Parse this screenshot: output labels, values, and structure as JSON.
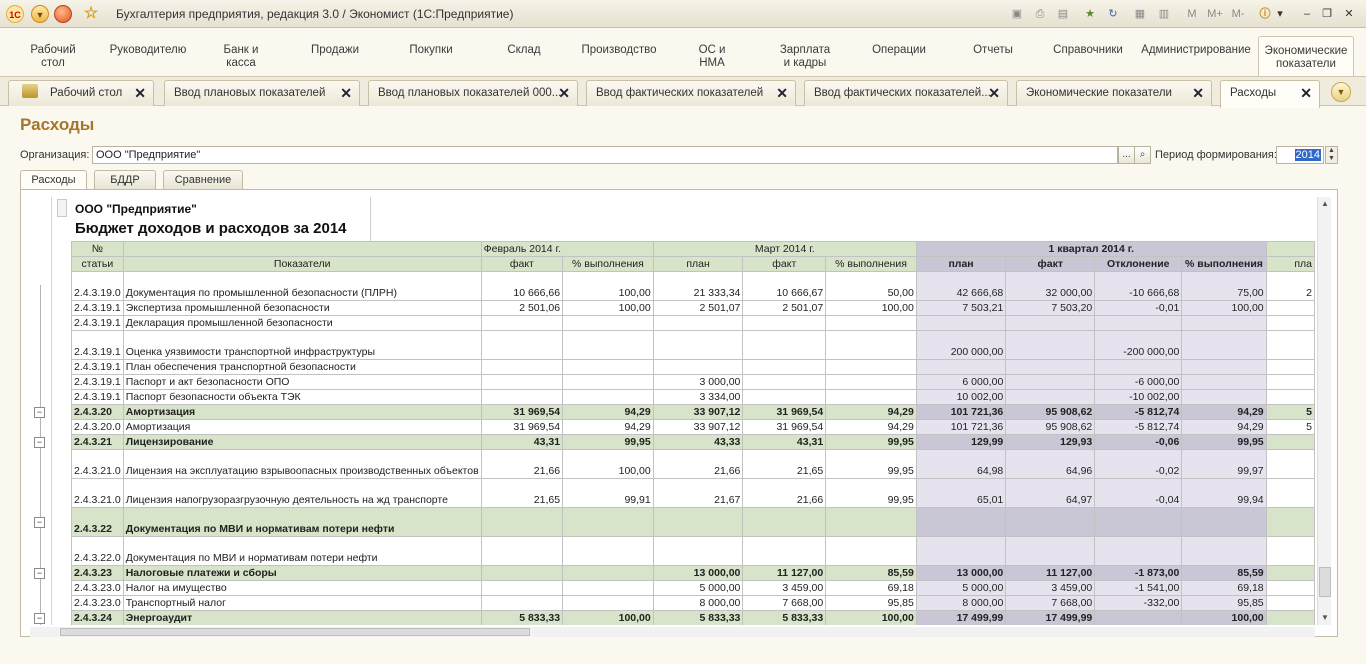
{
  "app": {
    "title": "Бухгалтерия предприятия, редакция 3.0 / Экономист  (1С:Предприятие)"
  },
  "titlebar_right": [
    "M",
    "M+",
    "M-"
  ],
  "sections": [
    {
      "label": "Рабочий\nстол"
    },
    {
      "label": "Руководителю"
    },
    {
      "label": "Банк и\nкасса"
    },
    {
      "label": "Продажи"
    },
    {
      "label": "Покупки"
    },
    {
      "label": "Склад"
    },
    {
      "label": "Производство"
    },
    {
      "label": "ОС и\nНМА"
    },
    {
      "label": "Зарплата\nи кадры"
    },
    {
      "label": "Операции"
    },
    {
      "label": "Отчеты"
    },
    {
      "label": "Справочники"
    },
    {
      "label": "Администрирование"
    },
    {
      "label": "Экономические\nпоказатели",
      "active": true
    }
  ],
  "tabs": [
    {
      "label": "Рабочий стол"
    },
    {
      "label": "Ввод плановых показателей"
    },
    {
      "label": "Ввод плановых показателей 000..."
    },
    {
      "label": "Ввод фактических показателей"
    },
    {
      "label": "Ввод фактических показателей..."
    },
    {
      "label": "Экономические показатели"
    },
    {
      "label": "Расходы",
      "active": true
    }
  ],
  "page": {
    "title": "Расходы",
    "org_label": "Организация:",
    "org_value": "ООО \"Предприятие\"",
    "period_label": "Период формирования:",
    "period_value": "2014",
    "subtabs": [
      "Расходы",
      "БДДР",
      "Сравнение"
    ]
  },
  "report": {
    "org": "ООО \"Предприятие\"",
    "title": "Бюджет доходов и расходов за 2014",
    "headers": {
      "no": "№",
      "no2": "статьи",
      "indicator": "Показатели",
      "feb": "Февраль 2014 г.",
      "mar": "Март 2014 г.",
      "q1": "1 квартал 2014 г.",
      "fact": "факт",
      "pct": "% выполнения",
      "plan": "план",
      "dev": "Отклонение",
      "next": "пла"
    },
    "rows": [
      {
        "code": "2.4.3.19.0",
        "name": "Документация по промышленной безопасности (ПЛРН)",
        "tall": true,
        "v": [
          "10 666,66",
          "100,00",
          "21 333,34",
          "10 666,67",
          "50,00",
          "42 666,68",
          "32 000,00",
          "-10 666,68",
          "75,00",
          "2"
        ]
      },
      {
        "code": "2.4.3.19.1",
        "name": "Экспертиза промышленной безопасности",
        "v": [
          "2 501,06",
          "100,00",
          "2 501,07",
          "2 501,07",
          "100,00",
          "7 503,21",
          "7 503,20",
          "-0,01",
          "100,00",
          ""
        ]
      },
      {
        "code": "2.4.3.19.1",
        "name": "Декларация промышленной безопасности",
        "v": [
          "",
          "",
          "",
          "",
          "",
          "",
          "",
          "",
          "",
          ""
        ]
      },
      {
        "code": "2.4.3.19.1",
        "name": "Оценка уязвимости транспортной инфраструктуры",
        "tall": true,
        "v": [
          "",
          "",
          "",
          "",
          "",
          "200 000,00",
          "",
          "-200 000,00",
          "",
          ""
        ]
      },
      {
        "code": "2.4.3.19.1",
        "name": "План обеспечения транспортной безопасности",
        "v": [
          "",
          "",
          "",
          "",
          "",
          "",
          "",
          "",
          "",
          ""
        ]
      },
      {
        "code": "2.4.3.19.1",
        "name": "Паспорт и акт безопасности ОПО",
        "v": [
          "",
          "",
          "3 000,00",
          "",
          "",
          "6 000,00",
          "",
          "-6 000,00",
          "",
          ""
        ]
      },
      {
        "code": "2.4.3.19.1",
        "name": "Паспорт безопасности объекта ТЭК",
        "v": [
          "",
          "",
          "3 334,00",
          "",
          "",
          "10 002,00",
          "",
          "-10 002,00",
          "",
          ""
        ]
      },
      {
        "code": "2.4.3.20",
        "name": "Амортизация",
        "grp": true,
        "v": [
          "31 969,54",
          "94,29",
          "33 907,12",
          "31 969,54",
          "94,29",
          "101 721,36",
          "95 908,62",
          "-5 812,74",
          "94,29",
          "5"
        ]
      },
      {
        "code": "2.4.3.20.0",
        "name": "Амортизация",
        "v": [
          "31 969,54",
          "94,29",
          "33 907,12",
          "31 969,54",
          "94,29",
          "101 721,36",
          "95 908,62",
          "-5 812,74",
          "94,29",
          "5"
        ]
      },
      {
        "code": "2.4.3.21",
        "name": "Лицензирование",
        "grp": true,
        "v": [
          "43,31",
          "99,95",
          "43,33",
          "43,31",
          "99,95",
          "129,99",
          "129,93",
          "-0,06",
          "99,95",
          ""
        ]
      },
      {
        "code": "2.4.3.21.0",
        "name": "Лицензия на эксплуатацию взрывоопасных производственных объектов",
        "tall": true,
        "v": [
          "21,66",
          "100,00",
          "21,66",
          "21,65",
          "99,95",
          "64,98",
          "64,96",
          "-0,02",
          "99,97",
          ""
        ]
      },
      {
        "code": "2.4.3.21.0",
        "name": "Лицензия напогрузоразгрузочную деятельность на жд транспорте",
        "tall": true,
        "v": [
          "21,65",
          "99,91",
          "21,67",
          "21,66",
          "99,95",
          "65,01",
          "64,97",
          "-0,04",
          "99,94",
          ""
        ]
      },
      {
        "code": "2.4.3.22",
        "name": "Документация по МВИ и нормативам потери нефти",
        "grp": true,
        "tall": true,
        "v": [
          "",
          "",
          "",
          "",
          "",
          "",
          "",
          "",
          "",
          ""
        ]
      },
      {
        "code": "2.4.3.22.0",
        "name": "Документация по МВИ и нормативам потери нефти",
        "tall": true,
        "v": [
          "",
          "",
          "",
          "",
          "",
          "",
          "",
          "",
          "",
          ""
        ]
      },
      {
        "code": "2.4.3.23",
        "name": "Налоговые платежи и сборы",
        "grp": true,
        "v": [
          "",
          "",
          "13 000,00",
          "11 127,00",
          "85,59",
          "13 000,00",
          "11 127,00",
          "-1 873,00",
          "85,59",
          ""
        ]
      },
      {
        "code": "2.4.3.23.0",
        "name": "Налог на имущество",
        "v": [
          "",
          "",
          "5 000,00",
          "3 459,00",
          "69,18",
          "5 000,00",
          "3 459,00",
          "-1 541,00",
          "69,18",
          ""
        ]
      },
      {
        "code": "2.4.3.23.0",
        "name": "Транспортный налог",
        "v": [
          "",
          "",
          "8 000,00",
          "7 668,00",
          "95,85",
          "8 000,00",
          "7 668,00",
          "-332,00",
          "95,85",
          ""
        ]
      },
      {
        "code": "2.4.3.24",
        "name": "Энергоаудит",
        "grp": true,
        "v": [
          "5 833,33",
          "100,00",
          "5 833,33",
          "5 833,33",
          "100,00",
          "17 499,99",
          "17 499,99",
          "",
          "100,00",
          ""
        ]
      },
      {
        "code": "2.4.3.24.0",
        "name": "Энергоаудит",
        "v": [
          "5 833,33",
          "100,00",
          "5 833,33",
          "5 833,33",
          "100,00",
          "17 499,99",
          "17 499,99",
          "",
          "100,00",
          ""
        ]
      }
    ]
  }
}
